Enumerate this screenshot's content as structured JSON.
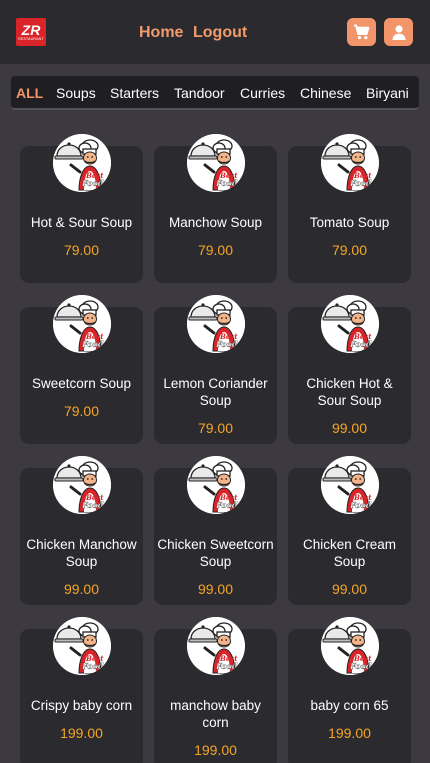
{
  "header": {
    "logo_text": "ZR",
    "logo_subtext": "RESTAURANT",
    "nav": {
      "home": "Home",
      "logout": "Logout"
    },
    "icons": {
      "cart": "cart-icon",
      "user": "user-icon"
    },
    "accent": "#f3956a"
  },
  "categories": [
    "ALL",
    "Soups",
    "Starters",
    "Tandoor",
    "Curries",
    "Chinese",
    "Biryani"
  ],
  "active_category": "ALL",
  "chef_badge_text": "Best Food",
  "items": [
    {
      "name": "Hot & Sour Soup",
      "price": "79.00"
    },
    {
      "name": "Manchow Soup",
      "price": "79.00"
    },
    {
      "name": "Tomato Soup",
      "price": "79.00"
    },
    {
      "name": "Sweetcorn Soup",
      "price": "79.00"
    },
    {
      "name": "Lemon Coriander Soup",
      "price": "79.00"
    },
    {
      "name": "Chicken Hot & Sour Soup",
      "price": "99.00"
    },
    {
      "name": "Chicken Manchow Soup",
      "price": "99.00"
    },
    {
      "name": "Chicken Sweetcorn Soup",
      "price": "99.00"
    },
    {
      "name": "Chicken Cream Soup",
      "price": "99.00"
    },
    {
      "name": "Crispy baby corn",
      "price": "199.00"
    },
    {
      "name": "manchow baby corn",
      "price": "199.00"
    },
    {
      "name": "baby corn 65",
      "price": "199.00"
    }
  ]
}
